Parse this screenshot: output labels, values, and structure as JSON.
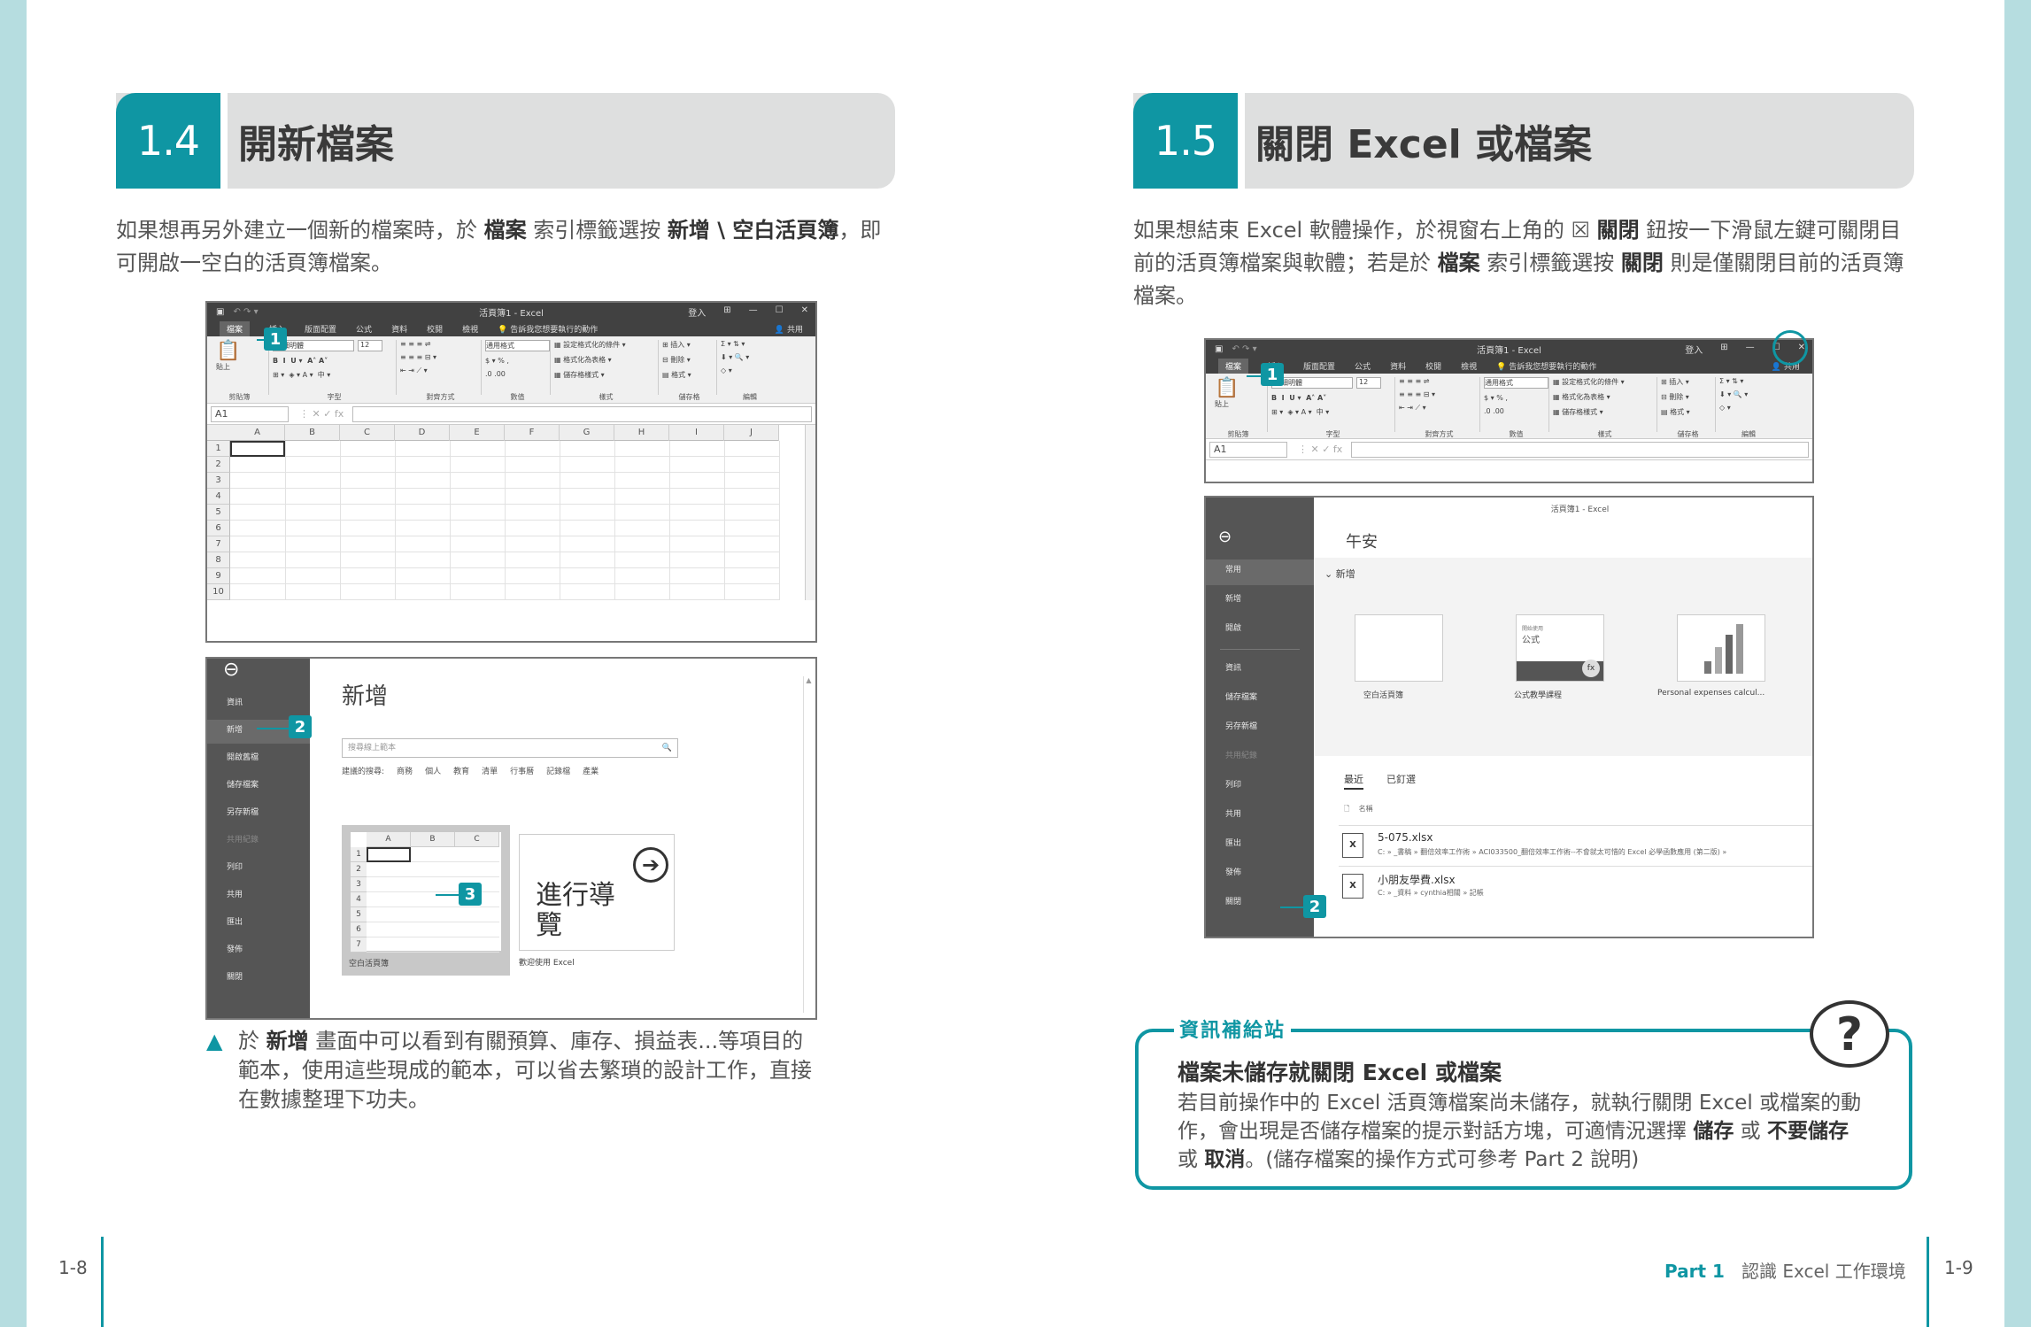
{
  "left": {
    "section_num": "1.4",
    "section_title": "開新檔案",
    "para_a": "如果想再另外建立一個新的檔案時，於 ",
    "para_b": "檔案",
    "para_c": " 索引標籤選按 ",
    "para_d": "新增 \\ 空白活頁簿",
    "para_e": "，即可開啟一空白的活頁簿檔案。",
    "caption_a": "於 ",
    "caption_b": "新增",
    "caption_c": " 畫面中可以看到有關預算、庫存、損益表...等項目的範本，使用這些現成的範本，可以省去繁瑣的設計工作，直接在數據整理下功夫。",
    "page_num": "1-8"
  },
  "right": {
    "section_num": "1.5",
    "section_title": "關閉 Excel 或檔案",
    "para_a": "如果想結束 Excel 軟體操作，於視窗右上角的 ",
    "close_glyph": "☒",
    "para_b": "關閉",
    "para_c": " 鈕按一下滑鼠左鍵可關閉目前的活頁簿檔案與軟體；若是於 ",
    "para_d": "檔案",
    "para_e": " 索引標籤選按 ",
    "para_f": "關閉",
    "para_g": " 則是僅關閉目前的活頁簿檔案。",
    "tip_label": "資訊補給站",
    "tip_title": "檔案未儲存就關閉 Excel 或檔案",
    "tip_a": "若目前操作中的 Excel 活頁簿檔案尚未儲存，就執行關閉 Excel 或檔案的動作，會出現是否儲存檔案的提示對話方塊，可適情況選擇 ",
    "tip_b": "儲存",
    "tip_c": " 或 ",
    "tip_d": "不要儲存",
    "tip_e": " 或 ",
    "tip_f": "取消",
    "tip_g": "。(儲存檔案的操作方式可參考 Part 2 說明)",
    "footer_part": "Part 1",
    "footer_title": "認識 Excel 工作環境",
    "page_num": "1-9"
  },
  "excel": {
    "title": "活頁簿1 - Excel",
    "user": "登入",
    "share": "共用",
    "tabs": [
      "檔案",
      "插入",
      "版面配置",
      "公式",
      "資料",
      "校閱",
      "檢視"
    ],
    "tellme": "告訴我您想要執行的動作",
    "font": "新細明體",
    "size": "12",
    "numfmt": "通用格式",
    "cond1": "設定格式化的條件",
    "cond2": "格式化為表格",
    "cond3": "儲存格樣式",
    "ins": "插入",
    "del": "刪除",
    "fmt": "格式",
    "groups": [
      "剪貼簿",
      "字型",
      "對齊方式",
      "數值",
      "樣式",
      "儲存格",
      "編輯"
    ],
    "paste": "貼上",
    "cellref": "A1",
    "cols": [
      "A",
      "B",
      "C",
      "D",
      "E",
      "F",
      "G",
      "H",
      "I",
      "J"
    ],
    "rows": [
      "1",
      "2",
      "3",
      "4",
      "5",
      "6",
      "7",
      "8",
      "9",
      "10"
    ]
  },
  "backstage_new": {
    "items": [
      "資訊",
      "新增",
      "開啟舊檔",
      "儲存檔案",
      "另存新檔",
      "共用紀錄",
      "列印",
      "共用",
      "匯出",
      "發佈",
      "關閉"
    ],
    "title": "新增",
    "search": "搜尋線上範本",
    "suggest": [
      "建議的搜尋:",
      "商務",
      "個人",
      "教育",
      "清單",
      "行事曆",
      "記錄檔",
      "產業"
    ],
    "tpl1": "空白活頁簿",
    "tpl2": "歡迎使用 Excel",
    "tour": "進行導覽",
    "mini_cols": [
      "A",
      "B",
      "C"
    ],
    "mini_rows": [
      "1",
      "2",
      "3",
      "4",
      "5",
      "6",
      "7"
    ]
  },
  "backstage_home": {
    "title": "活頁簿1 - Excel",
    "items": [
      "常用",
      "新增",
      "開啟",
      "資訊",
      "儲存檔案",
      "另存新檔",
      "共用紀錄",
      "列印",
      "共用",
      "匯出",
      "發佈",
      "關閉"
    ],
    "greeting": "午安",
    "new_label": "新增",
    "tpl1": "空白活頁簿",
    "tpl2": "公式教學課程",
    "tpl2_small": "開始使用",
    "tpl2_big": "公式",
    "tpl3": "Personal expenses calcul...",
    "recent": "最近",
    "pinned": "已釘選",
    "name_col": "名稱",
    "files": [
      {
        "name": "5-075.xlsx",
        "path": "C: » _書稿 » 翻倍效率工作術 » ACI033500_翻倍效率工作術--不會就太可惜的 Excel 必學函數應用 (第二版) »"
      },
      {
        "name": "小朋友學費.xlsx",
        "path": "C: » _資料 » cynthia相關 » 記帳"
      }
    ]
  },
  "callouts": [
    "1",
    "2",
    "3",
    "1",
    "2"
  ],
  "colors": {
    "accent": "#0f96a3",
    "side": "#b6dde0",
    "header_gray": "#dedfdf"
  }
}
